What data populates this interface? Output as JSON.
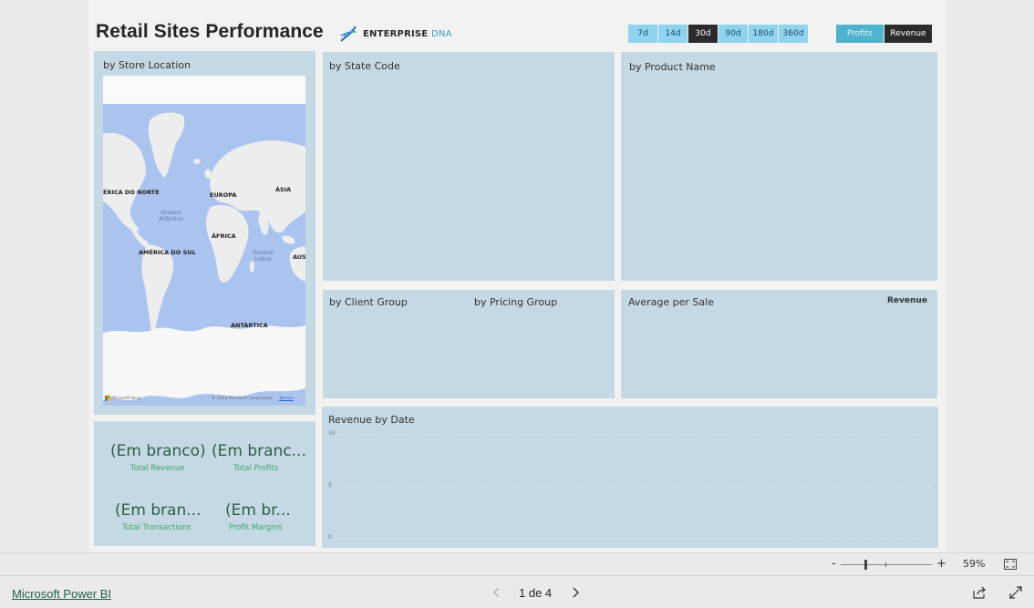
{
  "report": {
    "title": "Retail Sites Performance",
    "logo": {
      "brand": "ENTERPRISE",
      "suffix": "DNA",
      "icon": "dna-icon"
    }
  },
  "period_slicer": {
    "options": [
      "7d",
      "14d",
      "30d",
      "90d",
      "180d",
      "360d"
    ],
    "selected": "30d"
  },
  "metric_slicer": {
    "profits_label": "Profits",
    "revenue_label": "Revenue",
    "selected": "Revenue"
  },
  "visuals": {
    "store_location": {
      "title": "by Store Location",
      "labels": {
        "north_america": "ÉRICA DO NORTE",
        "europe": "EUROPA",
        "asia": "ÁSIA",
        "atlantic_1": "Oceano",
        "atlantic_2": "Atlântico",
        "africa": "ÁFRICA",
        "south_america": "AMÉRICA DO SUL",
        "indian_1": "Oceano",
        "indian_2": "Índico",
        "australia": "AUS",
        "antarctica": "ANTÁRTICA"
      },
      "credit_left": "Microsoft Bing",
      "credit_right": "© 2023 Microsoft Corporation",
      "terms": "Termos"
    },
    "state_code": {
      "title": "by State Code"
    },
    "product_name": {
      "title": "by Product Name"
    },
    "client_group": {
      "title": "by Client Group"
    },
    "pricing_group": {
      "title": "by Pricing Group"
    },
    "average_per_sale": {
      "title": "Average per Sale",
      "measure": "Revenue"
    },
    "kpis": [
      {
        "value": "(Em branco)",
        "label": "Total Revenue"
      },
      {
        "value": "(Em branc...",
        "label": "Total Profits"
      },
      {
        "value": "(Em bran...",
        "label": "Total Transactions"
      },
      {
        "value": "(Em br...",
        "label": "Profit Margins"
      }
    ],
    "revenue_by_date": {
      "title": "Revenue by Date",
      "y_ticks": [
        "10",
        "5",
        "0"
      ]
    }
  },
  "chart_data": {
    "type": "line",
    "title": "Revenue by Date",
    "ylim": [
      0,
      10
    ],
    "yticks": [
      0,
      5,
      10
    ],
    "series": [],
    "grid": true
  },
  "zoom": {
    "minus": "-",
    "plus": "+",
    "percent": "59%",
    "value": 0.59
  },
  "footer": {
    "link": "Microsoft Power BI",
    "pager": "1 de 4"
  },
  "colors": {
    "panel": "#c4d9e3",
    "period_button": "#8fd3ef",
    "active_button": "#2b2b2b",
    "profits_button": "#4fb3cc",
    "kpi_value": "#2f5e48",
    "kpi_label": "#3fa86a",
    "ocean": "#abc4ef",
    "land": "#ededed"
  }
}
